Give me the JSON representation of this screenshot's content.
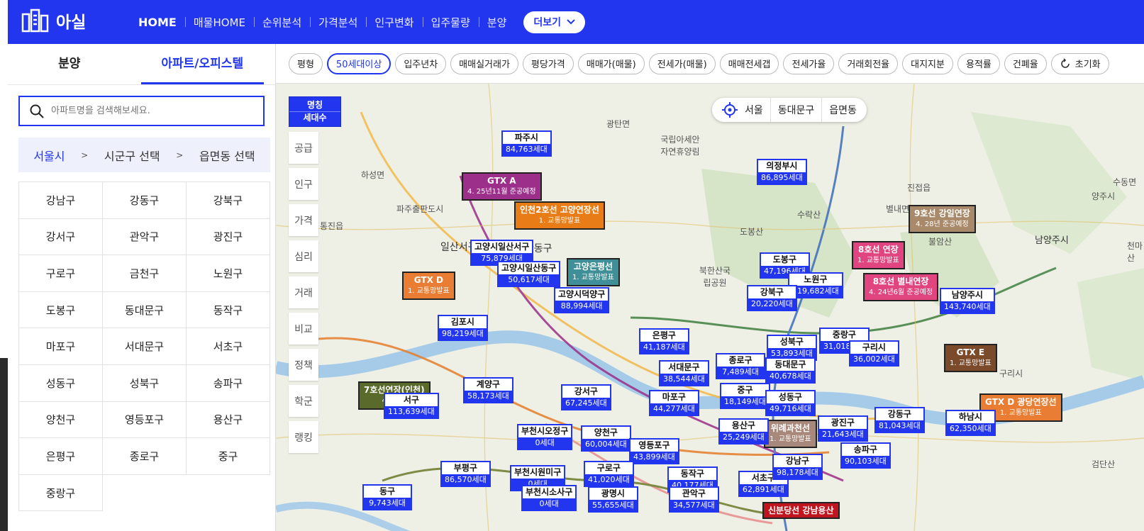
{
  "app": {
    "title": "아실"
  },
  "nav": {
    "items": [
      "HOME",
      "매물HOME",
      "순위분석",
      "가격분석",
      "인구변화",
      "입주물량",
      "분양"
    ],
    "more": "더보기"
  },
  "sidebar": {
    "tabs": [
      "분양",
      "아파트/오피스텔"
    ],
    "search_placeholder": "아파트명을 검색해보세요.",
    "breadcrumb": [
      "서울시",
      "시군구 선택",
      "읍면동 선택"
    ],
    "districts": [
      "강남구",
      "강동구",
      "강북구",
      "강서구",
      "관악구",
      "광진구",
      "구로구",
      "금천구",
      "노원구",
      "도봉구",
      "동대문구",
      "동작구",
      "마포구",
      "서대문구",
      "서초구",
      "성동구",
      "성북구",
      "송파구",
      "양천구",
      "영등포구",
      "용산구",
      "은평구",
      "종로구",
      "중구",
      "중랑구"
    ]
  },
  "filters": [
    "평형",
    "50세대이상",
    "입주년차",
    "매매실거래가",
    "평당가격",
    "매매가(매물)",
    "전세가(매물)",
    "매매전세갭",
    "전세가율",
    "거래회전율",
    "대지지분",
    "용적률",
    "건폐율",
    "초기화"
  ],
  "map": {
    "legend": [
      "명칭",
      "세대수"
    ],
    "tools": [
      "공급",
      "인구",
      "가격",
      "심리",
      "거래",
      "비교",
      "정책",
      "학군",
      "랭킹"
    ],
    "location": [
      "서울",
      "동대문구",
      "읍면동"
    ],
    "places": [
      "하성면",
      "파주출판도시",
      "통진읍",
      "광탄면",
      "국립아세안자연휴양림",
      "일산서구",
      "일산동구",
      "진접읍",
      "별내면",
      "북한산국립공원",
      "도봉산",
      "수락산",
      "남양주시",
      "양주시",
      "불암산",
      "천마산",
      "수동면",
      "구리시",
      "검단산"
    ],
    "markers": [
      {
        "name": "파주시",
        "count": "84,763세대"
      },
      {
        "name": "의정부시",
        "count": "86,895세대"
      },
      {
        "name": "고양시일산서구",
        "count": "75,879세대"
      },
      {
        "name": "고양시일산동구",
        "count": "50,617세대"
      },
      {
        "name": "고양시덕양구",
        "count": "88,994세대"
      },
      {
        "name": "도봉구",
        "count": "47,196세대"
      },
      {
        "name": "노원구",
        "count": "119,682세대"
      },
      {
        "name": "강북구",
        "count": "20,220세대"
      },
      {
        "name": "남양주시",
        "count": "143,740세대"
      },
      {
        "name": "김포시",
        "count": "98,219세대"
      },
      {
        "name": "은평구",
        "count": "41,187세대"
      },
      {
        "name": "성북구",
        "count": "53,893세대"
      },
      {
        "name": "중랑구",
        "count": "31,018세대"
      },
      {
        "name": "구리시",
        "count": "36,002세대"
      },
      {
        "name": "종로구",
        "count": "7,489세대"
      },
      {
        "name": "동대문구",
        "count": "40,678세대"
      },
      {
        "name": "서대문구",
        "count": "38,544세대"
      },
      {
        "name": "계양구",
        "count": "58,173세대"
      },
      {
        "name": "서구",
        "count": "113,639세대"
      },
      {
        "name": "강서구",
        "count": "67,245세대"
      },
      {
        "name": "마포구",
        "count": "44,277세대"
      },
      {
        "name": "중구",
        "count": "18,149세대"
      },
      {
        "name": "성동구",
        "count": "49,716세대"
      },
      {
        "name": "강동구",
        "count": "81,043세대"
      },
      {
        "name": "하남시",
        "count": "62,350세대"
      },
      {
        "name": "부천시오정구",
        "count": "0세대"
      },
      {
        "name": "양천구",
        "count": "60,004세대"
      },
      {
        "name": "용산구",
        "count": "25,249세대"
      },
      {
        "name": "광진구",
        "count": "21,643세대"
      },
      {
        "name": "영등포구",
        "count": "43,899세대"
      },
      {
        "name": "송파구",
        "count": "90,103세대"
      },
      {
        "name": "부평구",
        "count": "86,570세대"
      },
      {
        "name": "부천시원미구",
        "count": "0세대"
      },
      {
        "name": "구로구",
        "count": "41,020세대"
      },
      {
        "name": "동작구",
        "count": "40,177세대"
      },
      {
        "name": "서초구",
        "count": "62,891세대"
      },
      {
        "name": "강남구",
        "count": "98,178세대"
      },
      {
        "name": "동구",
        "count": "9,743세대"
      },
      {
        "name": "부천시소사구",
        "count": "0세대"
      },
      {
        "name": "광명시",
        "count": "55,655세대"
      },
      {
        "name": "관악구",
        "count": "34,577세대"
      }
    ],
    "lines": [
      {
        "name": "GTX A",
        "sub": "4. 25년11월 준공예정",
        "color": "#9b2f8a"
      },
      {
        "name": "인천2호선 고양연장선",
        "sub": "1. 교통망발표",
        "color": "#e87d17"
      },
      {
        "name": "고양은평선",
        "sub": "1. 교통망발표",
        "color": "#3e8f97"
      },
      {
        "name": "GTX D",
        "sub": "1. 교통망발표",
        "color": "#e87d33"
      },
      {
        "name": "9호선 강일연장",
        "sub": "4. 28년 준공예정",
        "color": "#a88a6a"
      },
      {
        "name": "8호선 연장",
        "sub": "1. 교통망발표",
        "color": "#e0457f"
      },
      {
        "name": "8호선 별내연장",
        "sub": "4. 24년6월 준공예정",
        "color": "#e0457f"
      },
      {
        "name": "GTX E",
        "sub": "1. 교통망발표",
        "color": "#7a4a2a"
      },
      {
        "name": "GTX D 광당연장선",
        "sub": "1. 교통망발표",
        "color": "#e87d33"
      },
      {
        "name": "7호선연장(인천)",
        "sub": "4. 27년",
        "color": "#5a6a2a"
      },
      {
        "name": "위례과천선",
        "sub": "1. 교통망발표",
        "color": "#a8887a"
      },
      {
        "name": "신분당선 강남용산",
        "sub": "",
        "color": "#c0141f"
      }
    ]
  }
}
